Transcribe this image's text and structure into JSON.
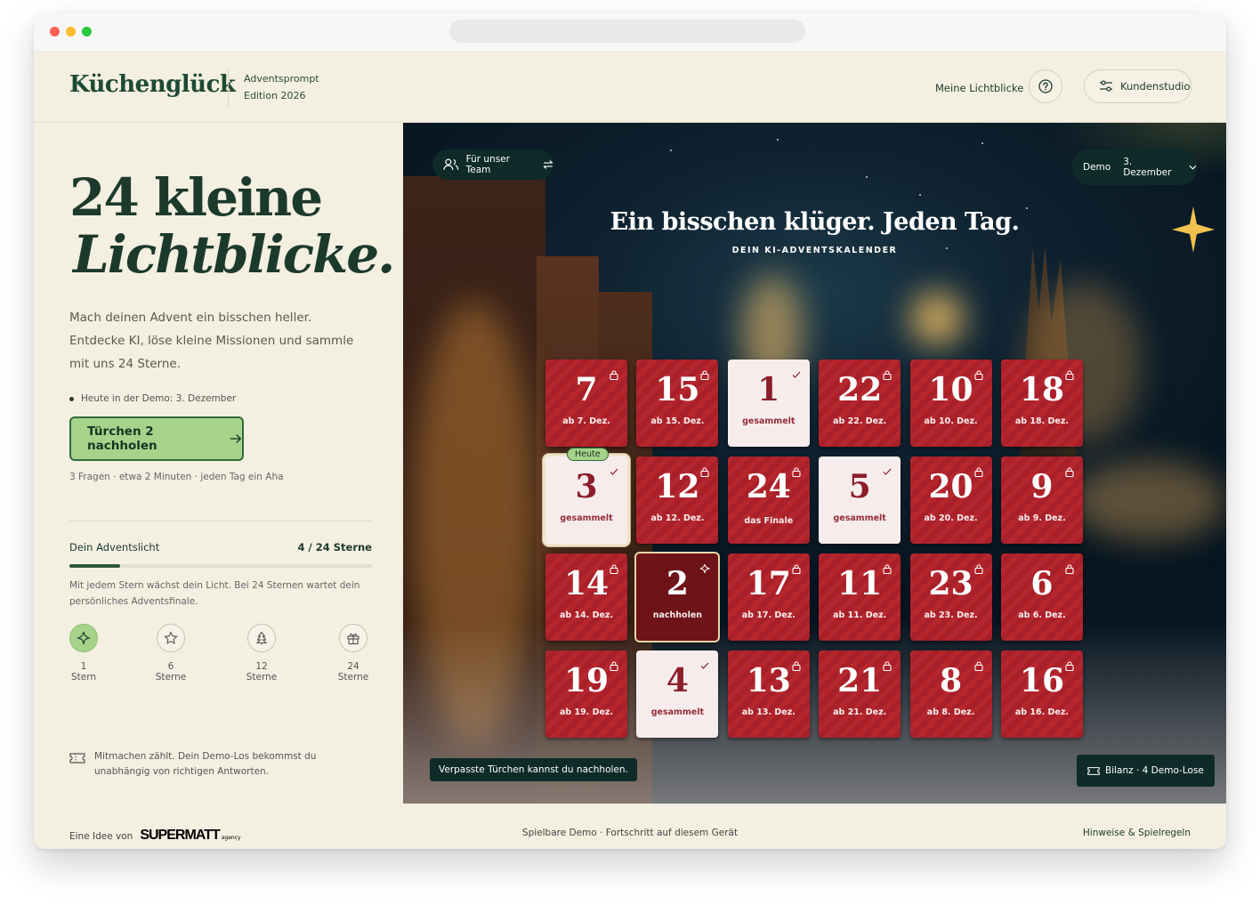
{
  "header": {
    "logo": "Küchenglück",
    "subtitle_line1": "Adventsprompt",
    "subtitle_line2": "Edition 2026",
    "nav_link": "Meine Lichtblicke",
    "studio_button": "Kundenstudio"
  },
  "left": {
    "headline_line1": "24 kleine",
    "headline_line2": "Lichtblicke.",
    "intro_line1": "Mach deinen Advent ein bisschen heller.",
    "intro_line2": "Entdecke KI, löse kleine Missionen und sammle",
    "intro_line3": "mit uns 24 Sterne.",
    "today_note": "Heute in der Demo: 3. Dezember",
    "cta_label": "Türchen 2 nachholen",
    "cta_note": "3 Fragen · etwa 2 Minuten · jeden Tag ein Aha",
    "progress_title": "Dein Adventslicht",
    "progress_value": "4 / 24 Sterne",
    "progress_fraction": 0.167,
    "progress_note": "Mit jedem Stern wächst dein Licht. Bei 24 Sternen wartet dein persönliches Adventsfinale.",
    "milestones": [
      {
        "label": "1 Stern",
        "icon": "sparkle-icon"
      },
      {
        "label": "6 Sterne",
        "icon": "star-icon"
      },
      {
        "label": "12 Sterne",
        "icon": "tree-icon"
      },
      {
        "label": "24 Sterne",
        "icon": "gift-icon"
      }
    ],
    "demo_note_line1": "Mitmachen zählt. Dein Demo-Los bekommst du",
    "demo_note_line2": "unabhängig von richtigen Antworten."
  },
  "hero": {
    "team_pill": "Für unser Team",
    "demo_label": "Demo",
    "date_select": "3. Dezember",
    "title": "Ein bisschen klüger. Jeden Tag.",
    "subtitle": "DEIN KI-ADVENTSKALENDER",
    "doors": [
      {
        "num": "7",
        "label": "ab 7. Dez.",
        "state": "locked"
      },
      {
        "num": "15",
        "label": "ab 15. Dez.",
        "state": "locked"
      },
      {
        "num": "1",
        "label": "gesammelt",
        "state": "collected"
      },
      {
        "num": "22",
        "label": "ab 22. Dez.",
        "state": "locked"
      },
      {
        "num": "10",
        "label": "ab 10. Dez.",
        "state": "locked"
      },
      {
        "num": "18",
        "label": "ab 18. Dez.",
        "state": "locked"
      },
      {
        "num": "3",
        "label": "gesammelt",
        "state": "today",
        "badge": "Heute"
      },
      {
        "num": "12",
        "label": "ab 12. Dez.",
        "state": "locked"
      },
      {
        "num": "24",
        "label": "das Finale",
        "state": "locked"
      },
      {
        "num": "5",
        "label": "gesammelt",
        "state": "collected"
      },
      {
        "num": "20",
        "label": "ab 20. Dez.",
        "state": "locked"
      },
      {
        "num": "9",
        "label": "ab 9. Dez.",
        "state": "locked"
      },
      {
        "num": "14",
        "label": "ab 14. Dez.",
        "state": "locked"
      },
      {
        "num": "2",
        "label": "nachholen",
        "state": "missed"
      },
      {
        "num": "17",
        "label": "ab 17. Dez.",
        "state": "locked"
      },
      {
        "num": "11",
        "label": "ab 11. Dez.",
        "state": "locked"
      },
      {
        "num": "23",
        "label": "ab 23. Dez.",
        "state": "locked"
      },
      {
        "num": "6",
        "label": "ab 6. Dez.",
        "state": "locked"
      },
      {
        "num": "19",
        "label": "ab 19. Dez.",
        "state": "locked"
      },
      {
        "num": "4",
        "label": "gesammelt",
        "state": "collected"
      },
      {
        "num": "13",
        "label": "ab 13. Dez.",
        "state": "locked"
      },
      {
        "num": "21",
        "label": "ab 21. Dez.",
        "state": "locked"
      },
      {
        "num": "8",
        "label": "ab 8. Dez.",
        "state": "locked"
      },
      {
        "num": "16",
        "label": "ab 16. Dez.",
        "state": "locked"
      }
    ],
    "missed_hint": "Verpasste Türchen kannst du nachholen.",
    "balance": "Bilanz · 4 Demo-Lose"
  },
  "footer": {
    "idea_prefix": "Eine Idee von",
    "brand": "SUPERMATT",
    "brand_sub": "agency",
    "center": "Spielbare Demo · Fortschritt auf diesem Gerät",
    "right_link": "Hinweise & Spielregeln"
  },
  "colors": {
    "brand_green": "#1d4a34",
    "cta_green": "#a6d38a",
    "door_red": "#b5262d",
    "background": "#f3efe1"
  }
}
